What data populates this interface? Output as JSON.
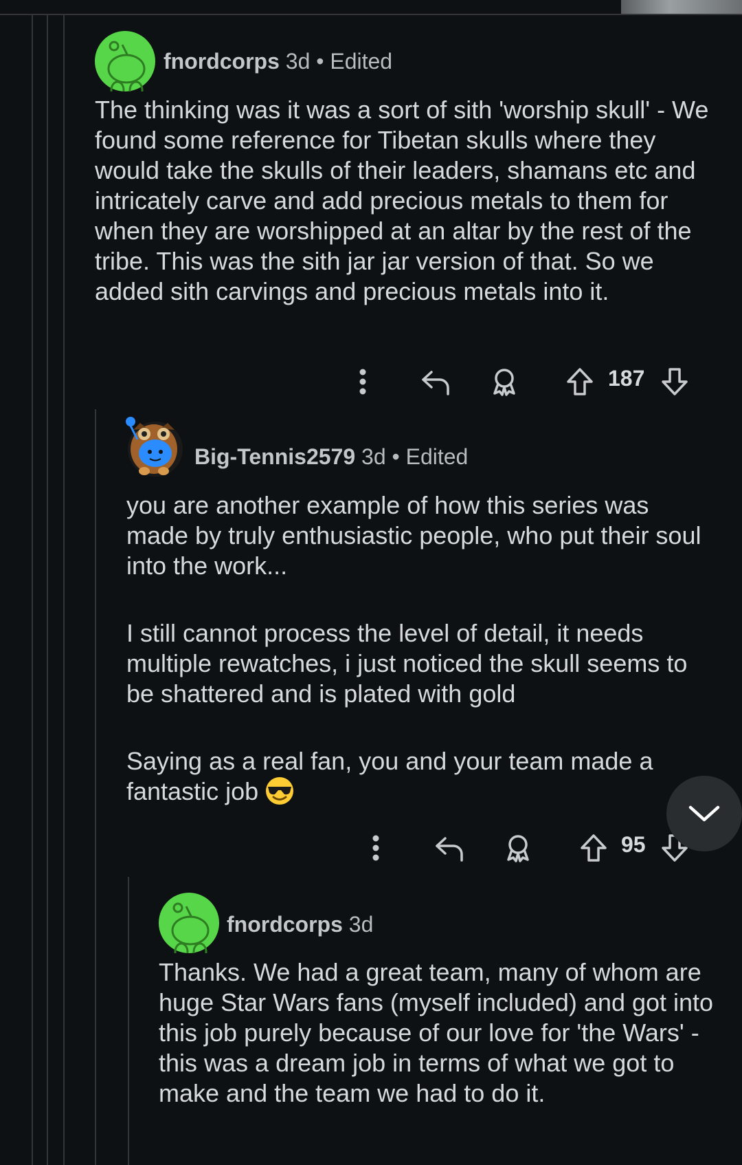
{
  "comments": [
    {
      "username": "fnordcorps",
      "time": "3d",
      "separator": "•",
      "edited": "Edited",
      "paragraphs": [
        "The thinking was it was a sort of sith 'worship skull' - We found some reference for Tibetan skulls where they would take the skulls of their leaders, shamans etc and intricately carve and add precious metals to them for when they are worshipped at an altar by the rest of the tribe. This was the sith jar jar version of that. So we added sith carvings and precious metals into it."
      ],
      "votes": "187"
    },
    {
      "username": "Big-Tennis2579",
      "time": "3d",
      "separator": "•",
      "edited": "Edited",
      "paragraphs": [
        "you are another example of how this series was made by truly enthusiastic people, who put their soul into the work...",
        "I still cannot process the level of detail, it needs multiple rewatches, i just noticed the skull seems to be shattered and is plated with gold",
        "Saying as a real fan, you and your team made a fantastic job"
      ],
      "votes": "95"
    },
    {
      "username": "fnordcorps",
      "time": "3d",
      "paragraphs": [
        "Thanks. We had a great team, many of whom are huge Star Wars fans (myself included) and got into this job purely because of our love for 'the Wars' - this was a dream job in terms of what we got to make and the team we had to do it."
      ]
    }
  ],
  "icons": {
    "more": "more-vertical-icon",
    "reply": "reply-icon",
    "award": "award-icon",
    "upvote": "upvote-icon",
    "downvote": "downvote-icon",
    "scroll_down": "chevron-down-icon",
    "emoji": "sunglasses-emoji-icon"
  },
  "colors": {
    "background": "#0e1113",
    "text": "#d7dadc",
    "avatar_green": "#58d64a",
    "thread_line": "#343536"
  }
}
